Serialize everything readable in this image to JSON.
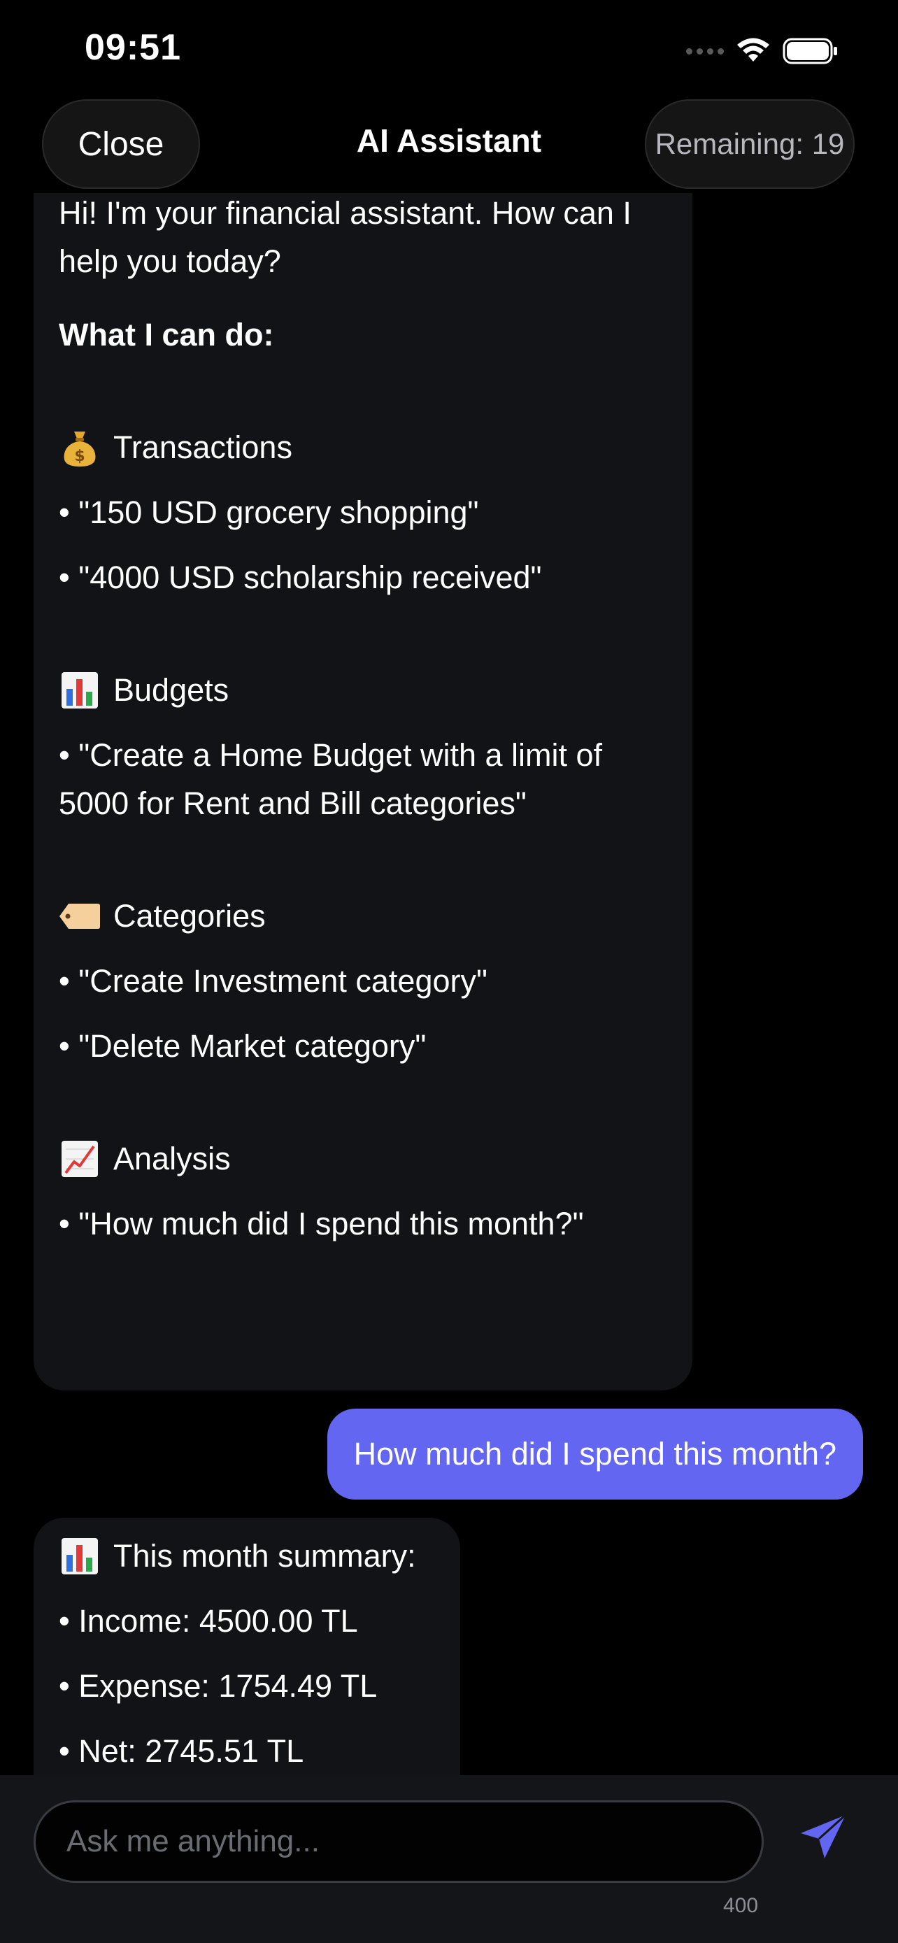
{
  "status_bar": {
    "time": "09:51",
    "icons": [
      "signal-icon",
      "wifi-icon",
      "battery-icon"
    ]
  },
  "header": {
    "close_label": "Close",
    "title": "AI Assistant",
    "remaining_label": "Remaining: 19"
  },
  "messages": {
    "welcome": {
      "intro": "Hi! I'm your financial assistant. How can I help you today?",
      "capabilities_heading": "What I can do:",
      "sections": [
        {
          "icon": "money-bag-icon",
          "title": "Transactions",
          "examples": [
            "• \"150 USD grocery shopping\"",
            "• \"4000 USD scholarship received\""
          ]
        },
        {
          "icon": "bar-chart-icon",
          "title": "Budgets",
          "examples": [
            "• \"Create a Home Budget with a limit of 5000 for Rent and Bill categories\""
          ]
        },
        {
          "icon": "label-tag-icon",
          "title": "Categories",
          "examples": [
            "• \"Create Investment category\"",
            "• \"Delete Market category\""
          ]
        },
        {
          "icon": "trending-up-chart-icon",
          "title": "Analysis",
          "examples": [
            "• \"How much did I spend this month?\""
          ]
        }
      ]
    },
    "user_question": "How much did I spend this month?",
    "summary": {
      "icon": "bar-chart-icon",
      "title": "This month summary:",
      "lines": [
        "• Income: 4500.00 TL",
        "• Expense: 1754.49 TL",
        "• Net: 2745.51 TL"
      ]
    }
  },
  "composer": {
    "placeholder": "Ask me anything...",
    "value": "",
    "char_limit": "400",
    "send_icon": "send-arrow-icon"
  },
  "colors": {
    "background": "#000000",
    "assistant_bubble": "#121316",
    "user_bubble": "#6366f1",
    "accent": "#6366f1"
  }
}
